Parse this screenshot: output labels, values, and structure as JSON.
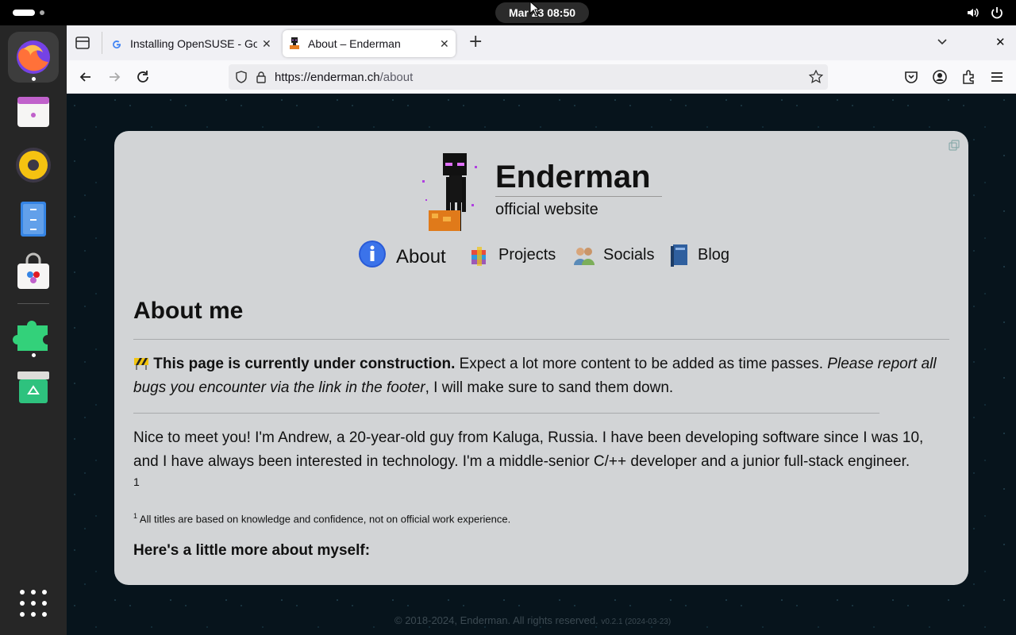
{
  "system": {
    "clock": "Mar 23  08:50"
  },
  "browser": {
    "tabs": [
      {
        "label": "Installing OpenSUSE - Go"
      },
      {
        "label": "About – Enderman"
      }
    ],
    "url_host": "https://enderman.ch",
    "url_path": "/about"
  },
  "site": {
    "title": "Enderman",
    "subtitle": "official website",
    "nav": [
      {
        "label": "About"
      },
      {
        "label": "Projects"
      },
      {
        "label": "Socials"
      },
      {
        "label": "Blog"
      }
    ]
  },
  "content": {
    "heading": "About me",
    "notice_bold": "This page is currently under construction.",
    "notice_text": " Expect a lot more content to be added as time passes. ",
    "notice_italic": "Please report all bugs you encounter via the link in the footer",
    "notice_tail": ", I will make sure to sand them down.",
    "intro": "Nice to meet you! I'm Andrew, a 20-year-old guy from Kaluga, Russia. I have been developing software since I was 10, and I have always been interested in technology. I'm a middle-senior C/++ developer and a junior full-stack engineer.",
    "footnote_ref": "1",
    "footnote_num": "1",
    "footnote_text": " All titles are based on knowledge and confidence, not on official work experience.",
    "subheading": "Here's a little more about myself:"
  },
  "footer": {
    "text": "© 2018-2024, Enderman. All rights reserved.",
    "version": "v0.2.1 (2024-03-23)"
  },
  "colors": {
    "card": "#d2d4d6",
    "background": "#07141c",
    "dock": "#262626"
  }
}
